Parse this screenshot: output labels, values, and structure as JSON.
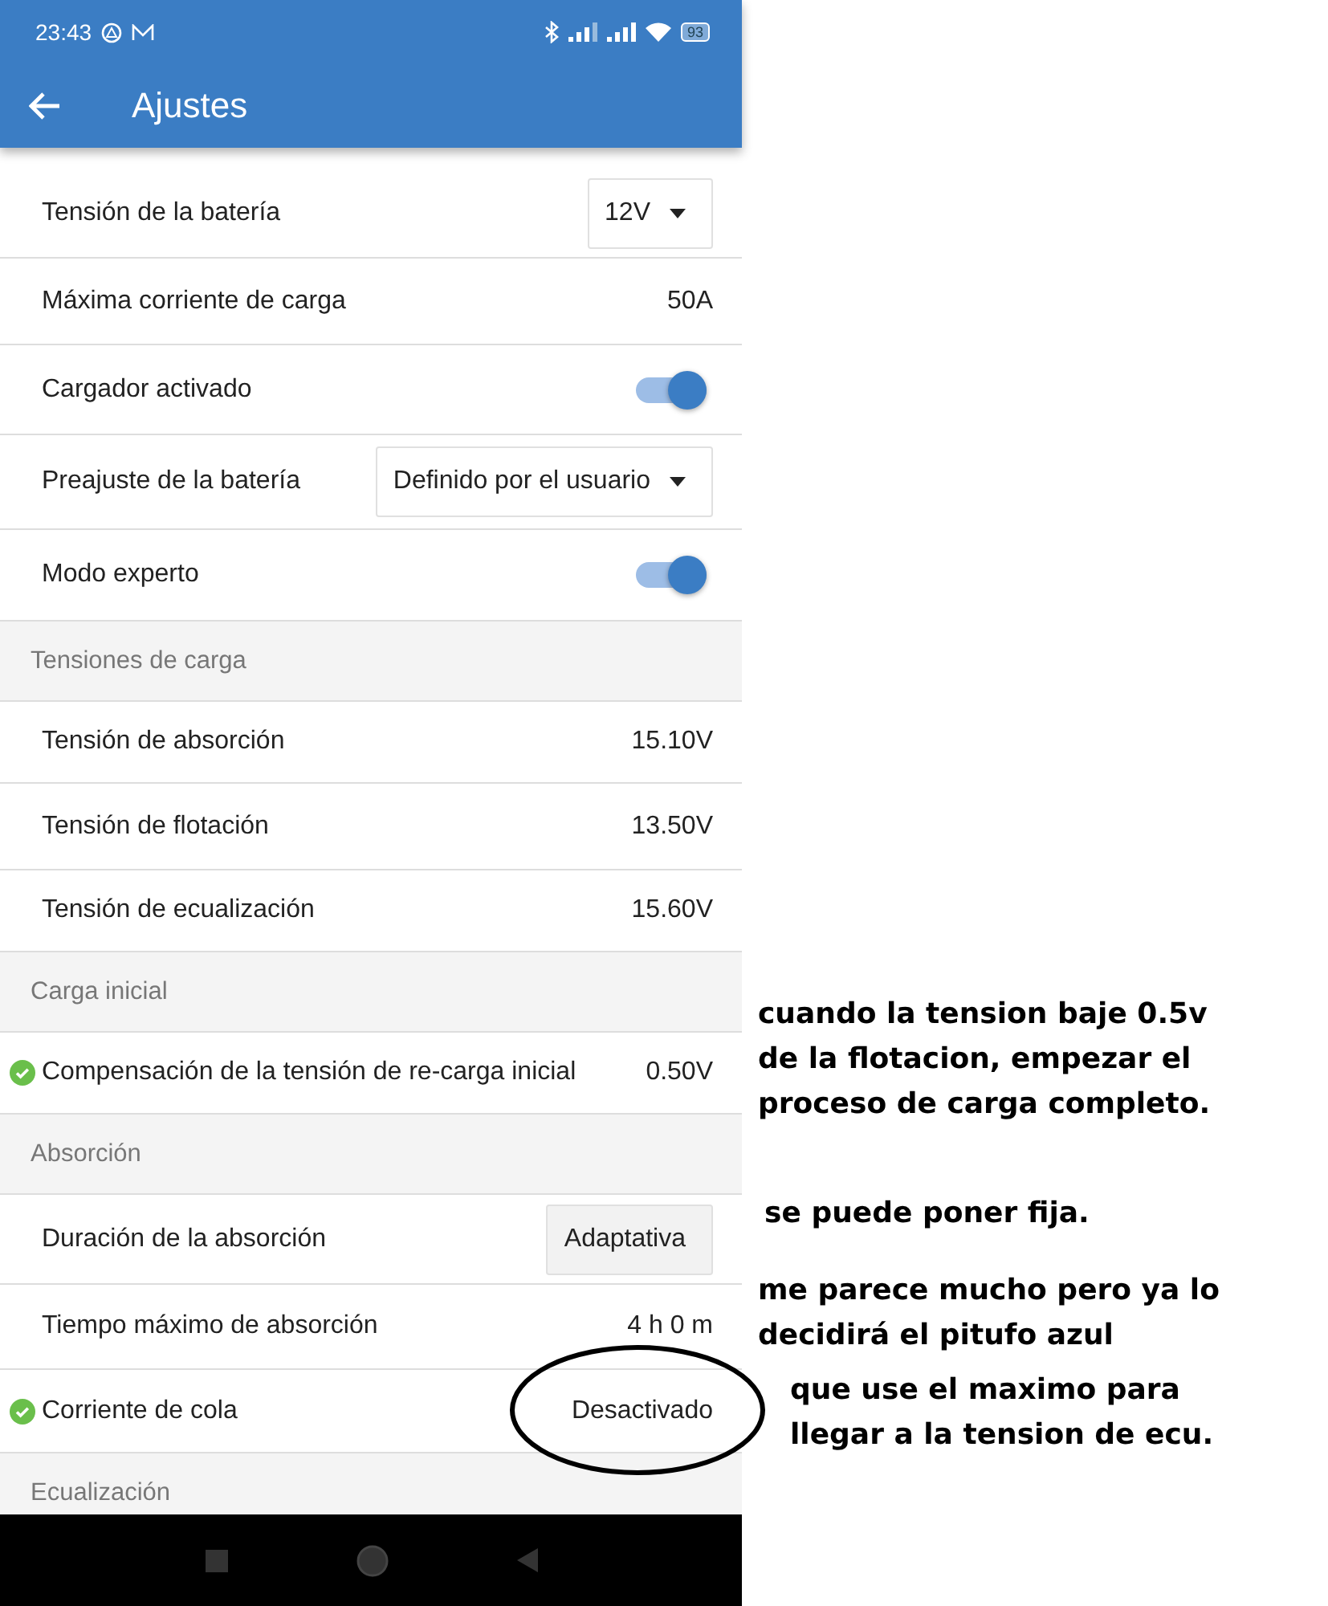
{
  "status_bar": {
    "time": "23:43",
    "battery": "93"
  },
  "toolbar": {
    "title": "Ajustes"
  },
  "settings": [
    {
      "kind": "dropdown",
      "label": "Tensión de la batería",
      "value": "12V",
      "verified": false
    },
    {
      "kind": "value",
      "label": "Máxima corriente de carga",
      "value": "50A",
      "verified": false
    },
    {
      "kind": "switch",
      "label": "Cargador activado",
      "on": true,
      "verified": false
    },
    {
      "kind": "dropdown",
      "label": "Preajuste de la batería",
      "value": "Definido por el usuario",
      "verified": false
    },
    {
      "kind": "switch",
      "label": "Modo experto",
      "on": true,
      "verified": false
    },
    {
      "kind": "section",
      "label": "Tensiones de carga"
    },
    {
      "kind": "value",
      "label": "Tensión de absorción",
      "value": "15.10V",
      "verified": false
    },
    {
      "kind": "value",
      "label": "Tensión de flotación",
      "value": "13.50V",
      "verified": false
    },
    {
      "kind": "value",
      "label": "Tensión de ecualización",
      "value": "15.60V",
      "verified": false
    },
    {
      "kind": "section",
      "label": "Carga inicial"
    },
    {
      "kind": "value",
      "label": "Compensación de la tensión de re-carga inicial",
      "value": "0.50V",
      "verified": true
    },
    {
      "kind": "section",
      "label": "Absorción"
    },
    {
      "kind": "button",
      "label": "Duración de la absorción",
      "value": "Adaptativa",
      "verified": false
    },
    {
      "kind": "value",
      "label": "Tiempo máximo de absorción",
      "value": "4 h 0 m",
      "verified": false
    },
    {
      "kind": "value",
      "label": "Corriente de cola",
      "value": "Desactivado",
      "verified": true
    },
    {
      "kind": "section",
      "label": "Ecualización"
    }
  ],
  "notes": [
    {
      "text": "cuando la tension baje 0.5v de la flotacion, empezar el proceso de carga completo."
    },
    {
      "text": "se puede poner fija."
    },
    {
      "text": "me parece mucho pero ya lo decidirá el pitufo azul"
    },
    {
      "text": "que use el maximo para llegar a la tension de ecu."
    }
  ]
}
